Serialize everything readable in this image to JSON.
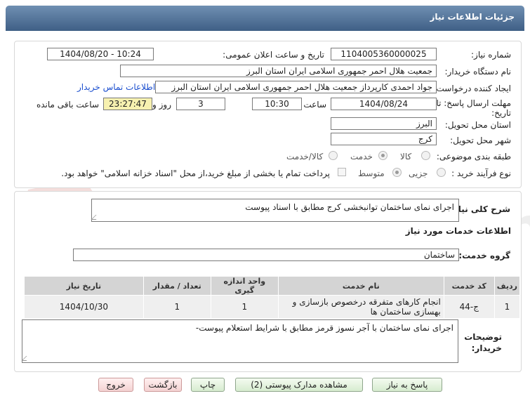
{
  "header": {
    "title": "جزئیات اطلاعات نیاز"
  },
  "info": {
    "need_number_label": "شماره نیاز:",
    "need_number": "1104005360000025",
    "announce_label": "تاریخ و ساعت اعلان عمومی:",
    "announce_value": "1404/08/20 - 10:24",
    "buyer_org_label": "نام دستگاه خریدار:",
    "buyer_org": "جمعیت هلال احمر جمهوری اسلامی ایران استان البرز",
    "creator_label": "ایجاد کننده درخواست:",
    "creator": "جواد احمدی کارپرداز جمعیت هلال احمر جمهوری اسلامی ایران استان البرز",
    "contact_link": "اطلاعات تماس خریدار",
    "deadline_label_1": "مهلت ارسال پاسخ: تا",
    "deadline_label_2": "تاریخ:",
    "deadline_date": "1404/08/24",
    "time_label": "ساعت",
    "deadline_time": "10:30",
    "days_value": "3",
    "days_label": "روز و",
    "remaining_time": "23:27:47",
    "remaining_label": "ساعت باقی مانده",
    "province_label": "استان محل تحویل:",
    "province": "البرز",
    "city_label": "شهر محل تحویل:",
    "city": "کرج",
    "category_label": "طبقه بندی موضوعی:",
    "category_options": [
      "کالا",
      "خدمت",
      "کالا/خدمت"
    ],
    "category_selected": 1,
    "purchase_type_label": "نوع فرآیند خرید :",
    "purchase_options": [
      "جزیی",
      "متوسط"
    ],
    "purchase_selected": 1,
    "payment_note": "پرداخت تمام یا بخشی از مبلغ خرید،از محل \"اسناد خزانه اسلامی\" خواهد بود."
  },
  "details": {
    "summary_label": "شرح کلی نیاز:",
    "summary": "اجرای نمای ساختمان توانبخشی کرج مطابق با اسناد پیوست",
    "services_heading": "اطلاعات خدمات مورد نیاز",
    "service_group_label": "گروه خدمت:",
    "service_group": "ساختمان",
    "table_headers": [
      "ردیف",
      "کد خدمت",
      "نام خدمت",
      "واحد اندازه گیری",
      "تعداد / مقدار",
      "تاریخ نیاز"
    ],
    "table_rows": [
      [
        "1",
        "ج-44",
        "انجام کارهای متفرقه درخصوص بازسازی و بهسازی ساختمان ها",
        "1",
        "1",
        "1404/10/30"
      ]
    ],
    "buyer_notes_label_1": "توضیحات",
    "buyer_notes_label_2": "خریدار:",
    "buyer_notes": "اجرای نمای ساختمان با آجر نسوز قرمز مطابق با شرایط استعلام پیوست-"
  },
  "buttons": {
    "reply": "پاسخ به نیاز",
    "view_docs": "مشاهده مدارک پیوستی (2)",
    "print": "چاپ",
    "back": "بازگشت",
    "exit": "خروج"
  },
  "watermark": {
    "text": "AriaTender.net"
  },
  "colors": {
    "header_top": "#6f8fb2",
    "header_bottom": "#3f5f86",
    "timer_bg": "#f7f1b0",
    "link": "#1a4ecf"
  }
}
